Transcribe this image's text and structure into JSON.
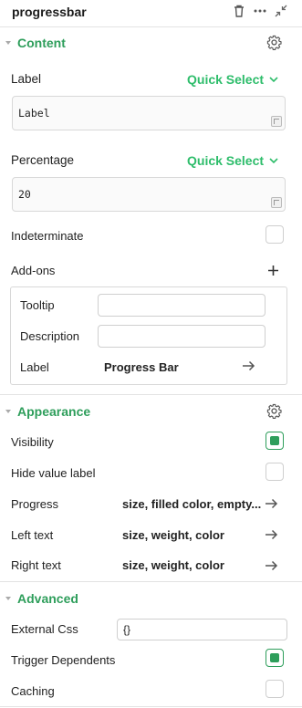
{
  "header": {
    "title": "progressbar"
  },
  "content": {
    "title": "Content",
    "label_field": {
      "label": "Label",
      "quick_select": "Quick Select",
      "value": "Label"
    },
    "percentage_field": {
      "label": "Percentage",
      "quick_select": "Quick Select",
      "value": "20"
    },
    "indeterminate": {
      "label": "Indeterminate",
      "checked": false
    },
    "addons": {
      "label": "Add-ons",
      "tooltip_label": "Tooltip",
      "tooltip_value": "",
      "description_label": "Description",
      "description_value": "",
      "label_label": "Label",
      "label_value": "Progress Bar"
    }
  },
  "appearance": {
    "title": "Appearance",
    "visibility": {
      "label": "Visibility",
      "checked": true
    },
    "hide_value_label": {
      "label": "Hide value label",
      "checked": false
    },
    "progress": {
      "label": "Progress",
      "value": "size, filled color, empty..."
    },
    "left_text": {
      "label": "Left text",
      "value": "size, weight, color"
    },
    "right_text": {
      "label": "Right text",
      "value": "size, weight, color"
    }
  },
  "advanced": {
    "title": "Advanced",
    "external_css": {
      "label": "External Css",
      "value": "{}"
    },
    "trigger_dependents": {
      "label": "Trigger Dependents",
      "checked": true
    },
    "caching": {
      "label": "Caching",
      "checked": false
    }
  },
  "colors": {
    "accent": "#2e9e5b",
    "quick_select": "#2ebd6b"
  },
  "icons": [
    "trash-icon",
    "more-icon",
    "collapse-icon",
    "gear-icon",
    "plus-icon",
    "arrow-right-icon",
    "resize-handle-icon"
  ]
}
